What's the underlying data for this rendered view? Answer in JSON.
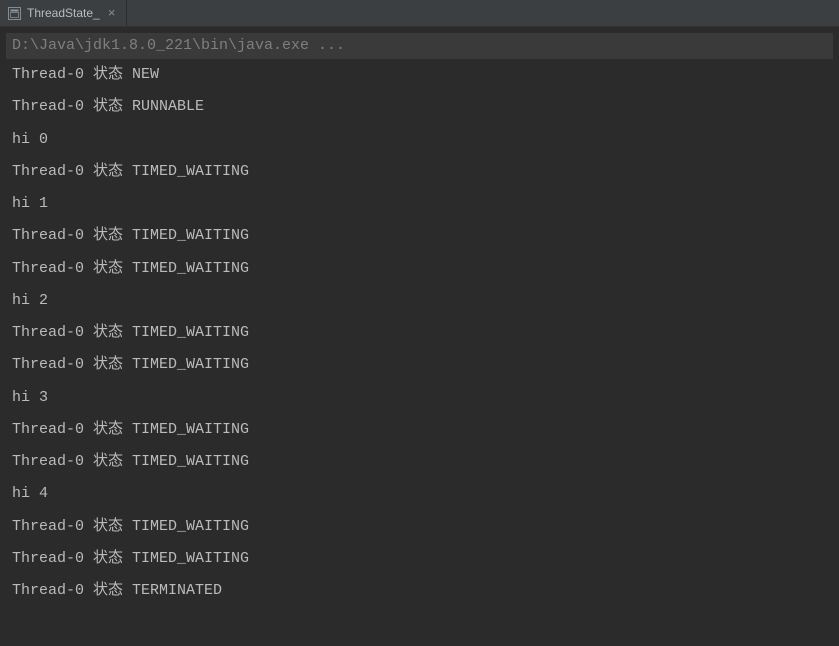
{
  "tab": {
    "title": "ThreadState_",
    "close_symbol": "×"
  },
  "console": {
    "command": "D:\\Java\\jdk1.8.0_221\\bin\\java.exe ...",
    "lines": [
      "Thread-0 状态 NEW",
      "Thread-0 状态 RUNNABLE",
      "hi 0",
      "Thread-0 状态 TIMED_WAITING",
      "hi 1",
      "Thread-0 状态 TIMED_WAITING",
      "Thread-0 状态 TIMED_WAITING",
      "hi 2",
      "Thread-0 状态 TIMED_WAITING",
      "Thread-0 状态 TIMED_WAITING",
      "hi 3",
      "Thread-0 状态 TIMED_WAITING",
      "Thread-0 状态 TIMED_WAITING",
      "hi 4",
      "Thread-0 状态 TIMED_WAITING",
      "Thread-0 状态 TIMED_WAITING",
      "Thread-0 状态 TERMINATED"
    ]
  }
}
